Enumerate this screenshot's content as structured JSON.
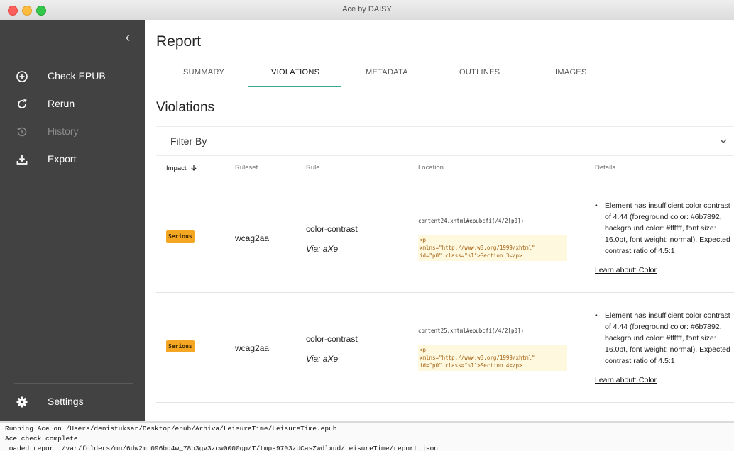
{
  "window": {
    "title": "Ace by DAISY"
  },
  "sidebar": {
    "collapse_icon": "chevron-left-icon",
    "items": [
      {
        "label": "Check EPUB",
        "icon": "add-circle-icon",
        "enabled": true
      },
      {
        "label": "Rerun",
        "icon": "refresh-icon",
        "enabled": true
      },
      {
        "label": "History",
        "icon": "history-icon",
        "enabled": false
      },
      {
        "label": "Export",
        "icon": "download-icon",
        "enabled": true
      }
    ],
    "settings_label": "Settings",
    "settings_icon": "gear-icon",
    "background": "#424242"
  },
  "report": {
    "title": "Report",
    "tabs": [
      {
        "label": "SUMMARY",
        "active": false
      },
      {
        "label": "VIOLATIONS",
        "active": true
      },
      {
        "label": "METADATA",
        "active": false
      },
      {
        "label": "OUTLINES",
        "active": false
      },
      {
        "label": "IMAGES",
        "active": false
      }
    ],
    "accent_color": "#37a79a"
  },
  "violations": {
    "title": "Violations",
    "filter_label": "Filter By",
    "columns": {
      "impact": "Impact",
      "ruleset": "Ruleset",
      "rule": "Rule",
      "location": "Location",
      "details": "Details"
    },
    "sort_icon": "arrow-down-icon",
    "rows": [
      {
        "impact": "Serious",
        "ruleset": "wcag2aa",
        "rule": "color-contrast",
        "via": "Via: aXe",
        "location": "content24.xhtml#epubcfi(/4/2[p0])",
        "snippet": "<p\nxmlns=\"http://www.w3.org/1999/xhtml\"\nid=\"p0\" class=\"s1\">Section 3</p>",
        "details": "Element has insufficient color contrast of 4.44 (foreground color: #6b7892, background color: #ffffff, font size: 16.0pt, font weight: normal). Expected contrast ratio of 4.5:1",
        "learn": "Learn about: Color"
      },
      {
        "impact": "Serious",
        "ruleset": "wcag2aa",
        "rule": "color-contrast",
        "via": "Via: aXe",
        "location": "content25.xhtml#epubcfi(/4/2[p0])",
        "snippet": "<p\nxmlns=\"http://www.w3.org/1999/xhtml\"\nid=\"p0\" class=\"s1\">Section 4</p>",
        "details": "Element has insufficient color contrast of 4.44 (foreground color: #6b7892, background color: #ffffff, font size: 16.0pt, font weight: normal). Expected contrast ratio of 4.5:1",
        "learn": "Learn about: Color"
      }
    ],
    "badge_color": "#f5a623"
  },
  "console": {
    "lines": [
      "Running Ace on /Users/denistuksar/Desktop/epub/Arhiva/LeisureTime/LeisureTime.epub",
      "Ace check complete",
      "Loaded report /var/folders/mn/6dw2mt096bg4w_78p3gv3zcw0000gp/T/tmp-9703zUCasZwdlxud/LeisureTime/report.json"
    ]
  }
}
